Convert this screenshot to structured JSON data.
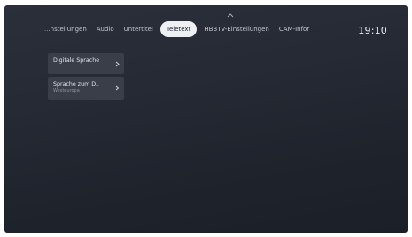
{
  "header": {
    "tabs": [
      {
        "label": "...nstellungen",
        "active": false
      },
      {
        "label": "Audio",
        "active": false
      },
      {
        "label": "Untertitel",
        "active": false
      },
      {
        "label": "Teletext",
        "active": true
      },
      {
        "label": "HBBTV-Einstellungen",
        "active": false
      },
      {
        "label": "CAM-Infor",
        "active": false
      }
    ],
    "clock": "19:10"
  },
  "menu": {
    "items": [
      {
        "label": "Digitale Sprache",
        "sub": ""
      },
      {
        "label": "Sprache zum D..",
        "sub": "Westeuropa"
      }
    ]
  },
  "colors": {
    "background": "#262a34",
    "active_tab": "#eef0f4",
    "menu_item": "#3a3e48"
  },
  "icons": [
    "chevron-up-icon",
    "chevron-right-icon"
  ]
}
